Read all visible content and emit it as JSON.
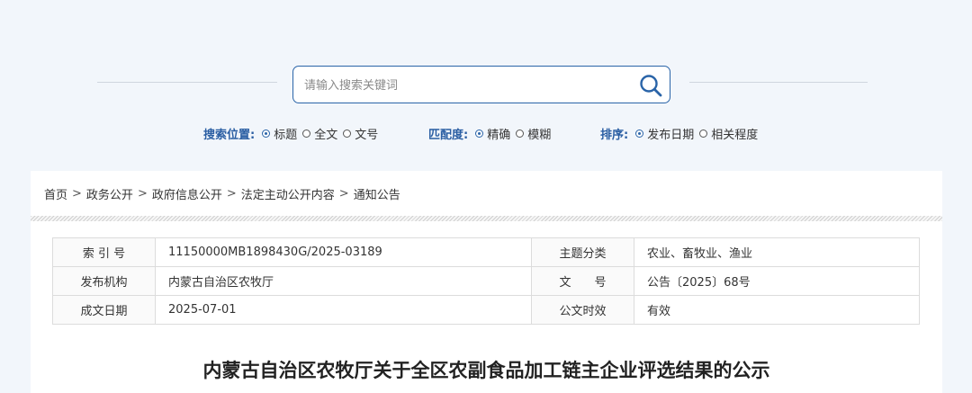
{
  "search": {
    "placeholder": "请输入搜索关键词"
  },
  "options": {
    "position": {
      "label": "搜索位置:",
      "items": [
        {
          "label": "标题",
          "selected": true
        },
        {
          "label": "全文",
          "selected": false
        },
        {
          "label": "文号",
          "selected": false
        }
      ]
    },
    "match": {
      "label": "匹配度:",
      "items": [
        {
          "label": "精确",
          "selected": true
        },
        {
          "label": "模糊",
          "selected": false
        }
      ]
    },
    "sort": {
      "label": "排序:",
      "items": [
        {
          "label": "发布日期",
          "selected": true
        },
        {
          "label": "相关程度",
          "selected": false
        }
      ]
    }
  },
  "breadcrumb": [
    "首页",
    "政务公开",
    "政府信息公开",
    "法定主动公开内容",
    "通知公告"
  ],
  "meta": {
    "index_label": "索 引 号",
    "index_value": "11150000MB1898430G/2025-03189",
    "topic_label": "主题分类",
    "topic_value": "农业、畜牧业、渔业",
    "org_label": "发布机构",
    "org_value": "内蒙古自治区农牧厅",
    "docno_label": "文　　号",
    "docno_value": "公告〔2025〕68号",
    "date_label": "成文日期",
    "date_value": "2025-07-01",
    "validity_label": "公文时效",
    "validity_value": "有效"
  },
  "title": "内蒙古自治区农牧厅关于全区农副食品加工链主企业评选结果的公示",
  "colors": {
    "accent": "#2a64a8",
    "option_label": "#2a5ea3",
    "background": "#f2f6fb"
  }
}
